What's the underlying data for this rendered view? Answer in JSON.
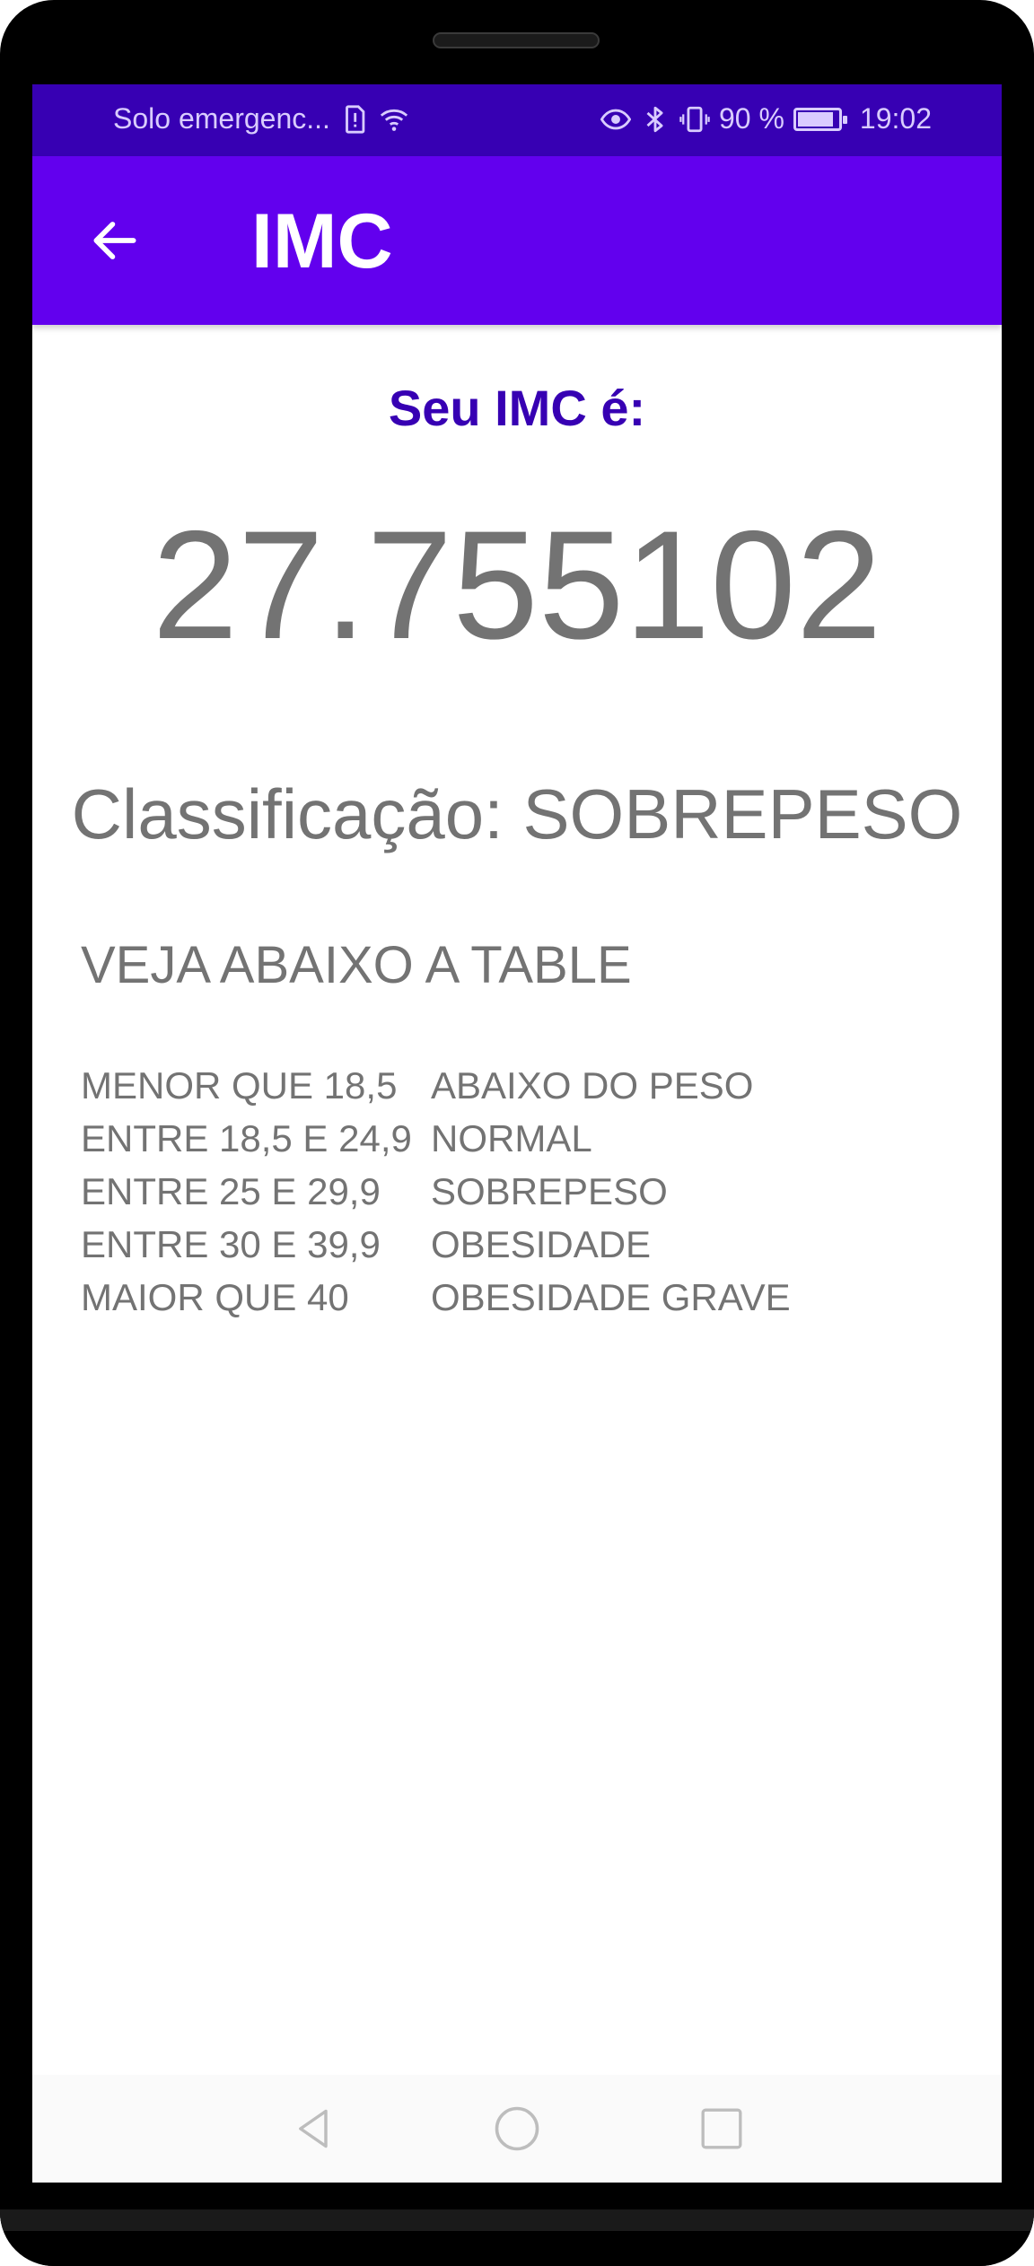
{
  "status_bar": {
    "carrier": "Solo emergenc...",
    "battery_percent": "90 %",
    "battery_level": 0.9,
    "time": "19:02",
    "icons": [
      "sim-alert-icon",
      "wifi-icon",
      "eye-comfort-icon",
      "bluetooth-icon",
      "vibrate-icon",
      "battery-icon"
    ]
  },
  "app_bar": {
    "title": "IMC",
    "back_icon": "arrow-back-icon"
  },
  "result": {
    "label": "Seu IMC é:",
    "value": "27.755102",
    "classification": "Classificação: SOBREPESO"
  },
  "table": {
    "heading": "VEJA ABAIXO A TABLE",
    "rows": [
      {
        "range": "MENOR QUE 18,5",
        "category": "ABAIXO DO PESO"
      },
      {
        "range": "ENTRE 18,5 E 24,9",
        "category": "NORMAL"
      },
      {
        "range": "ENTRE 25 E 29,9",
        "category": "SOBREPESO"
      },
      {
        "range": "ENTRE 30 E 39,9",
        "category": "OBESIDADE"
      },
      {
        "range": "MAIOR QUE 40",
        "category": "OBESIDADE GRAVE"
      }
    ]
  },
  "nav_bar": {
    "icons": [
      "nav-back-icon",
      "nav-home-icon",
      "nav-recents-icon"
    ]
  },
  "colors": {
    "status_bar": "#3700b3",
    "app_bar": "#6200ee",
    "label": "#3700b3",
    "text_gray": "#737373"
  }
}
